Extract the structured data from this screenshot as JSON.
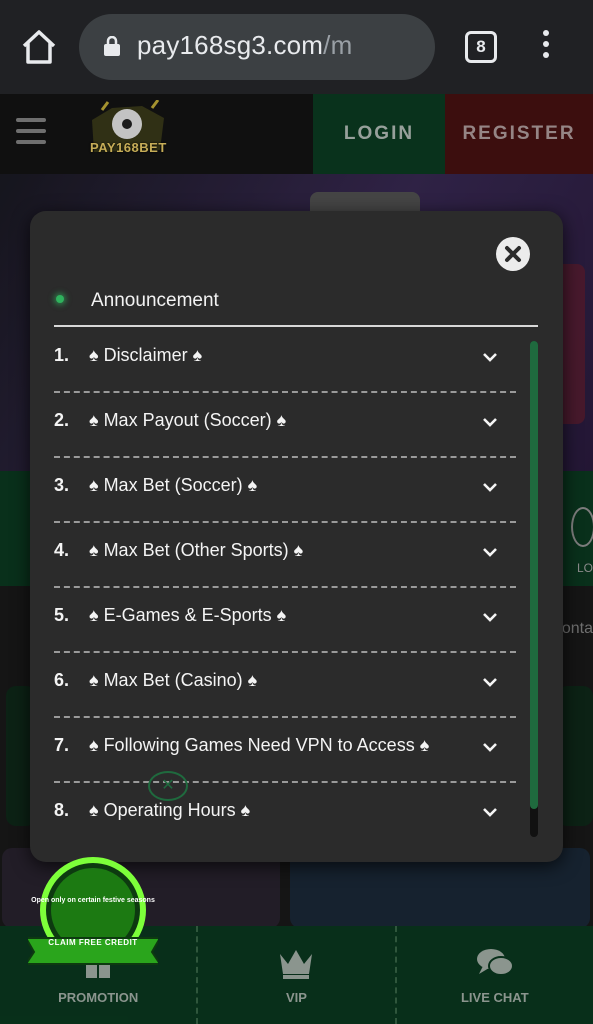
{
  "browser": {
    "url_host": "pay168sg3.com",
    "url_path": "/m",
    "tab_count": "8",
    "icons": [
      "home-icon",
      "lock-icon",
      "tabs-icon",
      "more-vert-icon"
    ]
  },
  "header": {
    "logo_text": "PAY168BET",
    "login_label": "LOGIN",
    "register_label": "REGISTER",
    "colors": {
      "login_bg": "#0c3d23",
      "register_bg": "#4a1212"
    }
  },
  "background": {
    "quick_label_right": "LO",
    "contact_text": "onta"
  },
  "modal": {
    "title": "Announcement",
    "items": [
      {
        "num": "1.",
        "label": "♠ Disclaimer ♠"
      },
      {
        "num": "2.",
        "label": "♠ Max Payout (Soccer) ♠"
      },
      {
        "num": "3.",
        "label": "♠ Max Bet (Soccer) ♠"
      },
      {
        "num": "4.",
        "label": "♠ Max Bet (Other Sports) ♠"
      },
      {
        "num": "5.",
        "label": "♠ E-Games & E-Sports ♠"
      },
      {
        "num": "6.",
        "label": "♠ Max Bet (Casino) ♠"
      },
      {
        "num": "7.",
        "label": "♠ Following Games Need VPN to Access ♠"
      },
      {
        "num": "8.",
        "label": "♠ Operating Hours ♠"
      }
    ],
    "accent_color": "#1f6a3e"
  },
  "promo_badge": {
    "text": "Open only on certain festive seasons",
    "ribbon": "CLAIM FREE CREDIT"
  },
  "bottom_nav": [
    {
      "label": "PROMOTION",
      "icon": "gift-icon"
    },
    {
      "label": "VIP",
      "icon": "crown-icon"
    },
    {
      "label": "LIVE CHAT",
      "icon": "chat-icon"
    }
  ]
}
